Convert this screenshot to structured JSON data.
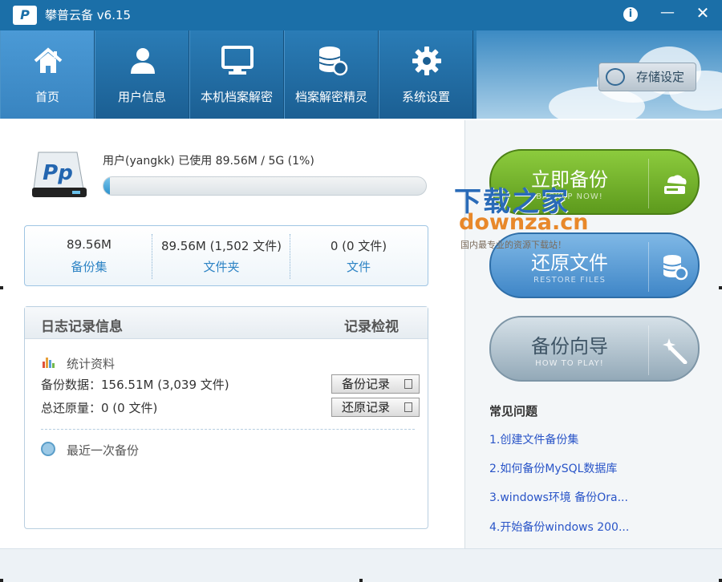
{
  "window": {
    "logo_text": "P",
    "title": "攀普云备 v6.15",
    "buttons": {
      "info": "i",
      "minimize": "—",
      "close": "✕"
    }
  },
  "nav": {
    "items": [
      {
        "label": "首页",
        "icon": "home-icon"
      },
      {
        "label": "用户信息",
        "icon": "user-icon"
      },
      {
        "label": "本机档案解密",
        "icon": "monitor-icon"
      },
      {
        "label": "档案解密精灵",
        "icon": "database-restore-icon"
      },
      {
        "label": "系统设置",
        "icon": "gear-icon"
      }
    ],
    "storage_button": "存储设定"
  },
  "usage": {
    "text": "用户(yangkk) 已使用 89.56M / 5G (1%)",
    "percent": 1
  },
  "stats": [
    {
      "value": "89.56M",
      "caption": "备份集"
    },
    {
      "value": "89.56M (1,502 文件)",
      "caption": "文件夹"
    },
    {
      "value": "0 (0 文件)",
      "caption": "文件"
    }
  ],
  "log": {
    "title": "日志记录信息",
    "view_link": "记录检视",
    "stats_label": "统计资料",
    "backup_data": "备份数据：156.51M (3,039 文件)",
    "restore_total": "总还原量：0 (0 文件)",
    "backup_log_button": "备份记录",
    "restore_log_button": "还原记录",
    "last_backup": "最近一次备份"
  },
  "actions": [
    {
      "label": "立即备份",
      "sub": "BACKUP NOW!",
      "icon": "cloud-upload-icon"
    },
    {
      "label": "还原文件",
      "sub": "RESTORE FILES",
      "icon": "database-restore-icon"
    },
    {
      "label": "备份向导",
      "sub": "HOW TO PLAY!",
      "icon": "magic-wand-icon"
    }
  ],
  "faq": {
    "title": "常见问题",
    "items": [
      "1.创建文件备份集",
      "2.如何备份MySQL数据库",
      "3.windows环境 备份Ora...",
      "4.开始备份windows 200..."
    ]
  },
  "watermark": {
    "line1": "下载之家",
    "line2": "downza.cn",
    "line3": "国内最专业的资源下载站！"
  },
  "colors": {
    "titlebar": "#1b6fa8",
    "accent_blue": "#2e84c5",
    "backup_green": "#6fae2a",
    "restore_blue": "#4f93cf",
    "link_blue": "#2a55c8"
  }
}
